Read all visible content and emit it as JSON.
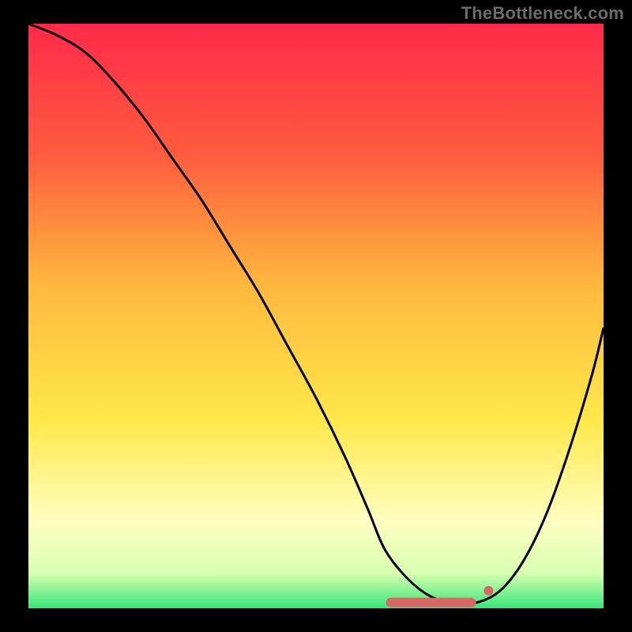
{
  "watermark": "TheBottleneck.com",
  "colors": {
    "gradient_top": "#ff2a4a",
    "gradient_mid1": "#ff8a3a",
    "gradient_mid2": "#ffe84a",
    "gradient_low": "#fffec0",
    "gradient_bottom": "#39e67a",
    "frame": "#000000",
    "curve": "#000000",
    "marker": "#d96763"
  },
  "chart_data": {
    "type": "line",
    "title": "",
    "xlabel": "",
    "ylabel": "",
    "xlim": [
      0,
      100
    ],
    "ylim": [
      0,
      100
    ],
    "grid": false,
    "legend": false,
    "series": [
      {
        "name": "bottleneck-curve",
        "x": [
          0,
          5,
          10,
          15,
          20,
          25,
          30,
          35,
          40,
          45,
          50,
          55,
          59,
          62,
          66,
          70,
          74,
          78,
          82,
          86,
          90,
          94,
          98,
          100
        ],
        "values": [
          100,
          98,
          95,
          90,
          84,
          77,
          70,
          62,
          54,
          45,
          36,
          26,
          17,
          10,
          5,
          2,
          1,
          1,
          3,
          8,
          16,
          27,
          40,
          48
        ]
      }
    ],
    "annotations": [
      {
        "name": "optimal-range",
        "type": "segment",
        "x_start": 63,
        "x_end": 77,
        "y": 1
      },
      {
        "name": "optimal-dot",
        "type": "point",
        "x": 80,
        "y": 3
      }
    ]
  }
}
